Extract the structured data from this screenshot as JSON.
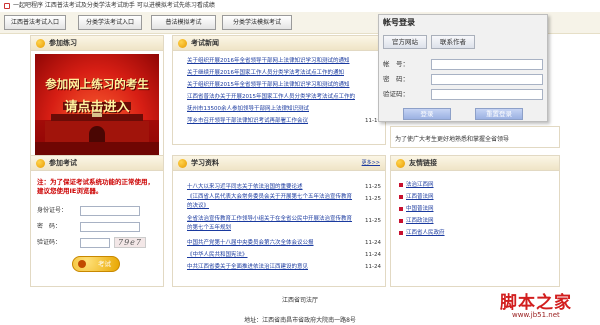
{
  "window": {
    "title": "一起吧程序 江西普法考试及分类学法考试助手 可以进模拟考试先练习看成绩"
  },
  "nav": {
    "buttons": [
      "江西普法考试入口",
      "分类学法考试入口",
      "普法模拟考试",
      "分类学法模拟考试"
    ]
  },
  "practice": {
    "title": "参加练习",
    "banner_line1": "参加网上练习的考生",
    "banner_line2": "请点击进入"
  },
  "news": {
    "title": "考试新闻",
    "items": [
      {
        "text": "关于组织开展2016年全省领导干部网上法律知识学习和测试的通知",
        "date": ""
      },
      {
        "text": "关于继续开展2016年国家工作人员分类学法考法试点工作的通知",
        "date": ""
      },
      {
        "text": "关于组织开展2015年全省领导干部网上法律知识学习和测试的通知",
        "date": ""
      },
      {
        "text": "江西省普法办关于开展2015年国家工作人员分类学法考法试点工作的",
        "date": ""
      },
      {
        "text": "抚州市13500余人参加领导干部网上法律知识测试",
        "date": ""
      },
      {
        "text": "萍乡市召开领导干部法律知识考试再部署工作会议",
        "date": "11-19"
      }
    ]
  },
  "login": {
    "title": "帐号登录",
    "tab_official": "官方网站",
    "tab_author": "联系作者",
    "account_label": "帐　号：",
    "password_label": "密　码：",
    "captcha_label": "验证码：",
    "login_button": "登录",
    "reset_button": "重置登录"
  },
  "notice_text": "为了使广大考生更好地熟悉和掌握全省领导",
  "exam": {
    "title": "参加考试",
    "warning": "注：为了保证考试系统功能的正常使用，建议您使用IE浏览器。",
    "id_label": "身份证号：",
    "pwd_label": "密　码：",
    "captcha_label": "验证码：",
    "captcha_code": "79e7",
    "exam_button": "考试"
  },
  "study": {
    "title": "学习资料",
    "more": "更多>>",
    "items": [
      {
        "text": "十八大以来习近平同志关于依法治国的重要论述",
        "date": "11-25"
      },
      {
        "text": "《江西省人民代表大会常务委员会关于开展第七个五年法治宣传教育的决议》",
        "date": "11-25"
      },
      {
        "text": "全省法治宣传教育工作领导小组关于在全省公民中开展法治宣传教育的第七个五年规划",
        "date": "11-25"
      },
      {
        "text": "中国共产党第十八届中央委员会第六次全体会议公报",
        "date": "11-24"
      },
      {
        "text": "《中华人民共和国宪法》",
        "date": "11-24"
      },
      {
        "text": "中共江西省委关于全面推进依法治江西建设的意见",
        "date": "11-24"
      }
    ]
  },
  "links": {
    "title": "友情链接",
    "items": [
      "法治江西网",
      "江西普法网",
      "中国普法网",
      "江西政法网",
      "江西省人民政府"
    ]
  },
  "footer": {
    "line1": "江西省司法厅",
    "line2": "地址：江西省南昌市省政府大院南一路8号"
  },
  "watermark": {
    "line1": "脚本之家",
    "line2": "www.jb51.net"
  },
  "colors": {
    "link": "#1a3a9f",
    "banner_red": "#c5140d",
    "warning_red": "#cc0000",
    "accent_orange": "#e89b00"
  }
}
